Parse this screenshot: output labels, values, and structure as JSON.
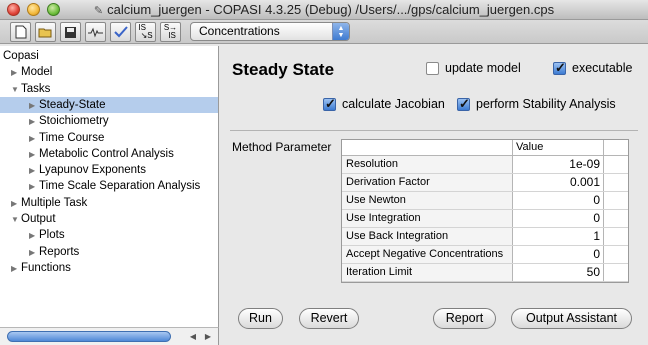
{
  "window": {
    "title": "calcium_juergen - COPASI 4.3.25 (Debug) /Users/.../gps/calcium_juergen.cps"
  },
  "toolbar": {
    "buttons": [
      "new-document-icon",
      "open-folder-icon",
      "save-disk-icon",
      "waveform-icon",
      "checkmark-icon",
      "steady-state-toggle-icon",
      "steady-state-convert-icon"
    ],
    "icon_labels": {
      "ss": "IS",
      "s": "S",
      "arrow": "S",
      "is": "IS"
    },
    "selector_value": "Concentrations"
  },
  "tree": {
    "items": [
      {
        "label": "Copasi",
        "level": 0,
        "arrow": ""
      },
      {
        "label": "Model",
        "level": 1,
        "arrow": "▶"
      },
      {
        "label": "Tasks",
        "level": 1,
        "arrow": "▼"
      },
      {
        "label": "Steady-State",
        "level": 2,
        "arrow": "▶"
      },
      {
        "label": "Stoichiometry",
        "level": 2,
        "arrow": "▶"
      },
      {
        "label": "Time Course",
        "level": 2,
        "arrow": "▶"
      },
      {
        "label": "Metabolic Control Analysis",
        "level": 2,
        "arrow": "▶"
      },
      {
        "label": "Lyapunov Exponents",
        "level": 2,
        "arrow": "▶"
      },
      {
        "label": "Time Scale Separation Analysis",
        "level": 2,
        "arrow": "▶"
      },
      {
        "label": "Multiple Task",
        "level": 1,
        "arrow": "▶"
      },
      {
        "label": "Output",
        "level": 1,
        "arrow": "▼"
      },
      {
        "label": "Plots",
        "level": 2,
        "arrow": "▶"
      },
      {
        "label": "Reports",
        "level": 2,
        "arrow": "▶"
      },
      {
        "label": "Functions",
        "level": 1,
        "arrow": "▶"
      }
    ],
    "selected_index": 3
  },
  "main": {
    "heading": "Steady State",
    "update_model_label": "update model",
    "update_model_checked": false,
    "executable_label": "executable",
    "executable_checked": true,
    "calc_jacobian_label": "calculate Jacobian",
    "calc_jacobian_checked": true,
    "stability_label": "perform Stability Analysis",
    "stability_checked": true,
    "method_label": "Method Parameter",
    "table": {
      "value_header": "Value",
      "rows": [
        {
          "name": "Resolution",
          "value": "1e-09"
        },
        {
          "name": "Derivation Factor",
          "value": "0.001"
        },
        {
          "name": "Use Newton",
          "value": "0"
        },
        {
          "name": "Use Integration",
          "value": "0"
        },
        {
          "name": "Use Back Integration",
          "value": "1"
        },
        {
          "name": "Accept Negative Concentrations",
          "value": "0"
        },
        {
          "name": "Iteration Limit",
          "value": "50"
        }
      ]
    },
    "buttons": {
      "run": "Run",
      "revert": "Revert",
      "report": "Report",
      "output_assistant": "Output Assistant"
    }
  },
  "colors": {
    "selection": "#b5cdec",
    "accent": "#3d7bd2"
  }
}
